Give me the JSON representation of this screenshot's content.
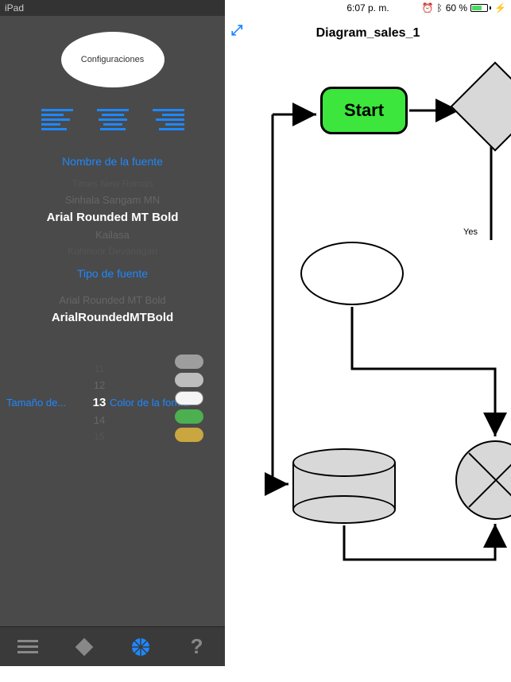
{
  "status": {
    "device": "iPad",
    "time": "6:07 p. m.",
    "battery": "60 %",
    "bt": "✱"
  },
  "sidebar": {
    "title": "Configuraciones",
    "font_name_label": "Nombre de la fuente",
    "font_names": [
      "Times New Roman",
      "Sinhala Sangam MN",
      "Arial Rounded MT Bold",
      "Kailasa",
      "Kohinoor Devanagari"
    ],
    "font_type_label": "Tipo de fuente",
    "font_types_faded": "Arial Rounded MT Bold",
    "font_types_selected": "ArialRoundedMTBold",
    "size_label": "Tamaño de...",
    "color_label": "Color de la forma",
    "sizes": [
      "11",
      "12",
      "13",
      "14",
      "15"
    ],
    "colors": [
      "#9e9e9e",
      "#bdbdbd",
      "#f5f5f5",
      "#4caf50",
      "#c9a63f"
    ]
  },
  "canvas": {
    "title": "Diagram_sales_1",
    "start": "Start",
    "yes": "Yes"
  }
}
